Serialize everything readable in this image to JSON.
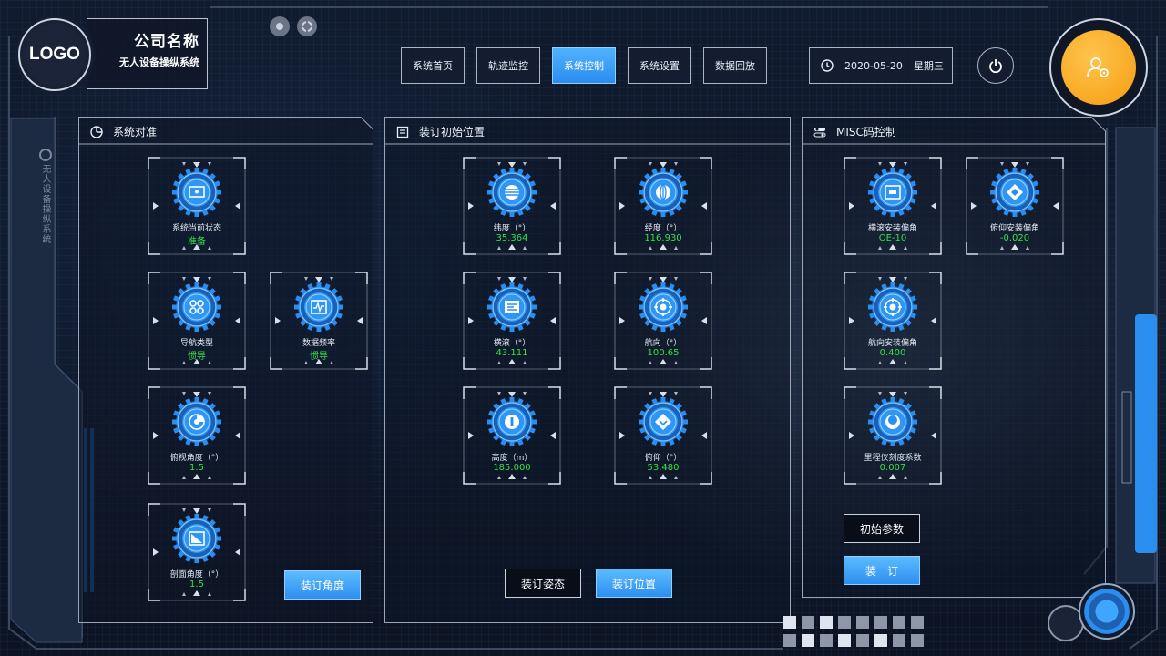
{
  "brand": {
    "logo": "LOGO",
    "company": "公司名称",
    "system": "无人设备操纵系统"
  },
  "side_text": "无人设备操纵系统",
  "nav": [
    {
      "label": "系统首页",
      "active": false
    },
    {
      "label": "轨迹监控",
      "active": false
    },
    {
      "label": "系统控制",
      "active": true
    },
    {
      "label": "系统设置",
      "active": false
    },
    {
      "label": "数据回放",
      "active": false
    }
  ],
  "header": {
    "date": "2020-05-20",
    "weekday": "星期三"
  },
  "colors": {
    "accent_blue": "#2b8cf0",
    "value_green": "#35e04a",
    "user_orange": "#f59d10"
  },
  "panels": {
    "calibration": {
      "title": "系统对准",
      "icon": "pie-clock-icon",
      "tiles": [
        {
          "label": "系统当前状态",
          "value": "准备",
          "icon": "monitor-icon"
        },
        {
          "label": "导航类型",
          "value": "惯导",
          "icon": "grid-dots-icon"
        },
        {
          "label": "数据频率",
          "value": "惯导",
          "icon": "waveform-icon"
        },
        {
          "label": "俯视角度（°）",
          "value": "1.5",
          "icon": "pie-chart-icon"
        },
        {
          "label": "剖面角度（°）",
          "value": "1.5",
          "icon": "slope-icon"
        }
      ],
      "button": "装订角度"
    },
    "position": {
      "title": "装订初始位置",
      "icon": "list-icon",
      "tiles": [
        {
          "label": "纬度（°）",
          "value": "35.364",
          "icon": "latitude-icon"
        },
        {
          "label": "经度（°）",
          "value": "116.930",
          "icon": "longitude-icon"
        },
        {
          "label": "横滚（°）",
          "value": "43.111",
          "icon": "roll-icon"
        },
        {
          "label": "航向（°）",
          "value": "100.65",
          "icon": "compass-icon"
        },
        {
          "label": "高度（m）",
          "value": "185.000",
          "icon": "altitude-icon"
        },
        {
          "label": "俯仰（°）",
          "value": "53.480",
          "icon": "pitch-icon"
        }
      ],
      "button_attitude": "装订姿态",
      "button_position": "装订位置"
    },
    "misc": {
      "title": "MISC码控制",
      "icon": "toggle-icon",
      "tiles": [
        {
          "label": "横滚安装偏角",
          "value": "OE-10",
          "icon": "roll-offset-icon"
        },
        {
          "label": "俯仰安装偏角",
          "value": "-0.020",
          "icon": "pitch-offset-icon"
        },
        {
          "label": "航向安装偏角",
          "value": "0.400",
          "icon": "heading-offset-icon"
        },
        {
          "label": "里程仪刻度系数",
          "value": "0.007",
          "icon": "odometer-icon"
        }
      ],
      "button_init": "初始参数",
      "button_bind": "装　订"
    }
  }
}
